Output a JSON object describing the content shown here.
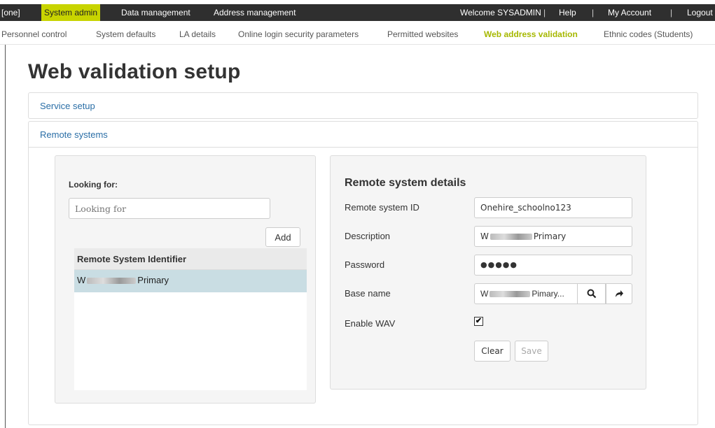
{
  "topnav": {
    "home": "[one]",
    "items": [
      "System admin",
      "Data management",
      "Address management"
    ],
    "welcome": "Welcome SYSADMIN",
    "help": "Help",
    "account": "My Account",
    "logout": "Logout"
  },
  "subnav": {
    "items": [
      "Personnel control",
      "System defaults",
      "LA details",
      "Online login security parameters",
      "Permitted websites",
      "Web address validation",
      "Ethnic codes (Students)"
    ]
  },
  "page": {
    "title": "Web validation setup"
  },
  "panels": {
    "service": "Service setup",
    "remote": "Remote systems"
  },
  "search": {
    "label": "Looking for:",
    "placeholder": "Looking for",
    "add": "Add",
    "column": "Remote System Identifier",
    "row_prefix": "W",
    "row_suffix": "Primary"
  },
  "details": {
    "title": "Remote system details",
    "id_label": "Remote system ID",
    "id_value": "Onehire_schoolno123",
    "desc_label": "Description",
    "desc_prefix": "W",
    "desc_suffix": "Primary",
    "pwd_label": "Password",
    "pwd_value": "●●●●●",
    "base_label": "Base name",
    "base_prefix": "W",
    "base_suffix": "Pimary...",
    "wav_label": "Enable WAV",
    "wav_checked": "✔",
    "clear": "Clear",
    "save": "Save"
  },
  "colors": {
    "accent": "#c8d400",
    "link": "#2a6ea6",
    "selected_row": "#c9dde3"
  }
}
